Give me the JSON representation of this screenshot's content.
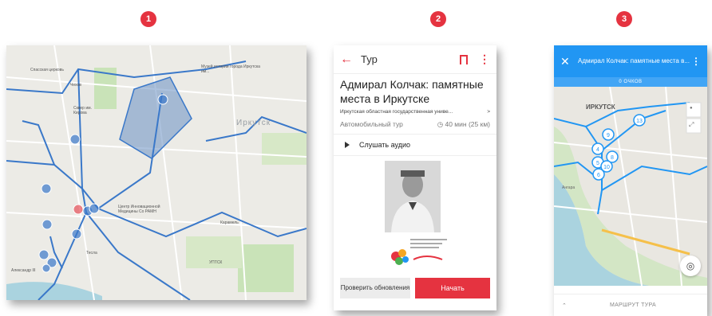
{
  "steps": [
    "1",
    "2",
    "3"
  ],
  "map1": {
    "labels": {
      "church": "Спасская церковь",
      "chekhov": "Чехов",
      "skver": "Сквер им. Кирова",
      "museum": "Музей истории города Иркутска им...",
      "irkutsk": "Иркутск",
      "medcenter": "Центр Инновационной Медицины Со РАМН",
      "karamel": "Карамель",
      "tesla": "Тесла",
      "uptsk": "УПТСК",
      "alexander": "Александр III"
    },
    "route_color": "#3a78c9",
    "area_color": "#6a8fc2"
  },
  "tour_details": {
    "back_icon": "arrow-left-icon",
    "title": "Тур",
    "name": "Адмирал Колчак: памятные места в Иркутске",
    "organization": "Иркутская областная государственная униве...",
    "org_arrow": ">",
    "type": "Автомобильный тур",
    "duration": "40 мин (25 км)",
    "audio_label": "Слушать аудио",
    "check_updates": "Проверить обновления",
    "start": "Начать",
    "accent": "#e53340"
  },
  "tour_map": {
    "title": "Адмирал Колчак: памятные места в...",
    "score": "0 ОЧКОВ",
    "city_label": "ИРКУТСК",
    "angara_label": "Ангара",
    "markers": [
      "13",
      "9",
      "4",
      "8",
      "5",
      "10",
      "6"
    ],
    "route_label": "МАРШРУТ ТУРА",
    "accent": "#2196f3"
  }
}
